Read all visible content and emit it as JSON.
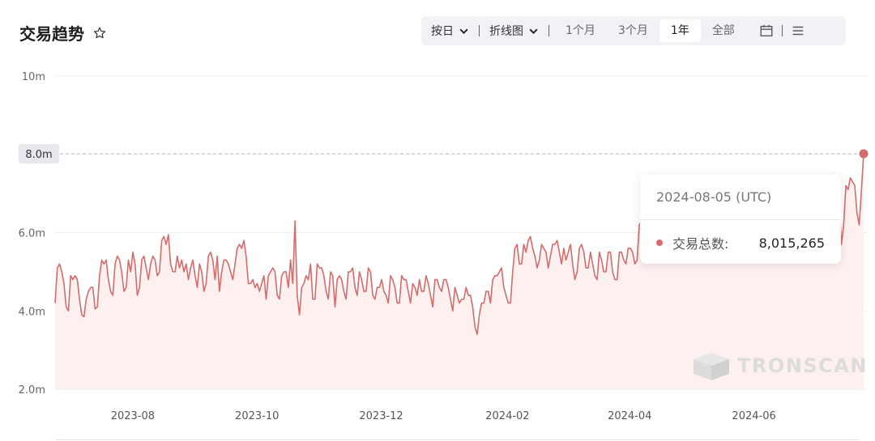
{
  "header": {
    "title": "交易趋势"
  },
  "toolbar": {
    "interval": "按日",
    "chart_kind": "折线图",
    "ranges": [
      "1个月",
      "3个月",
      "1年",
      "全部"
    ],
    "active_range": "1年"
  },
  "tooltip": {
    "date": "2024-08-05 (UTC)",
    "label": "交易总数:",
    "value": "8,015,265"
  },
  "crosshair_label": "8.0m",
  "watermark": "TRONSCAN",
  "colors": {
    "line": "#d66b6b",
    "area": "#fdf0ef",
    "tooltip_dot": "#d66b6b"
  },
  "chart_data": {
    "type": "area",
    "title": "交易趋势",
    "xlabel": "",
    "ylabel": "",
    "ylim": [
      2000000,
      10000000
    ],
    "yticks": [
      2000000,
      4000000,
      6000000,
      8000000,
      10000000
    ],
    "ytick_labels": [
      "2.0m",
      "4.0m",
      "6.0m",
      "8.0m",
      "10m"
    ],
    "xticks": [
      "2023-08-01",
      "2023-10-01",
      "2023-12-01",
      "2024-02-01",
      "2024-04-01",
      "2024-06-01"
    ],
    "xtick_labels": [
      "2023-08",
      "2023-10",
      "2023-12",
      "2024-02",
      "2024-04",
      "2024-06"
    ],
    "x_range": [
      "2023-07-05",
      "2024-08-05"
    ],
    "grid": true,
    "legend": "none",
    "series": [
      {
        "x_start": "2023-07-05",
        "x_step_days": 1,
        "values": [
          4.2,
          5.1,
          5.2,
          5.0,
          4.7,
          4.1,
          4.0,
          4.9,
          4.8,
          4.9,
          4.8,
          4.3,
          3.9,
          3.85,
          4.3,
          4.5,
          4.6,
          4.6,
          4.05,
          4.1,
          4.9,
          5.3,
          5.2,
          5.3,
          4.8,
          4.5,
          4.4,
          5.2,
          5.4,
          5.3,
          5.0,
          4.5,
          4.6,
          5.3,
          5.0,
          5.5,
          5.2,
          4.4,
          4.6,
          5.3,
          5.4,
          5.1,
          4.8,
          5.2,
          5.4,
          5.3,
          4.9,
          5.0,
          5.8,
          5.9,
          5.7,
          5.95,
          5.2,
          5.0,
          5.0,
          5.4,
          5.1,
          5.3,
          5.0,
          5.2,
          4.8,
          5.1,
          5.3,
          4.9,
          4.6,
          5.2,
          5.0,
          4.5,
          4.7,
          5.4,
          5.5,
          5.3,
          4.8,
          5.4,
          4.5,
          5.0,
          5.3,
          5.3,
          5.2,
          5.0,
          4.8,
          5.2,
          5.6,
          5.7,
          5.6,
          5.8,
          5.4,
          4.7,
          4.7,
          4.8,
          4.6,
          4.7,
          4.5,
          4.7,
          4.9,
          4.3,
          4.9,
          5.0,
          5.1,
          5.0,
          4.4,
          4.3,
          4.9,
          5.0,
          5.0,
          4.6,
          5.3,
          4.7,
          6.3,
          4.4,
          3.9,
          4.6,
          4.7,
          4.9,
          4.8,
          5.2,
          4.3,
          4.3,
          5.2,
          5.1,
          5.1,
          4.9,
          4.5,
          4.3,
          5.0,
          4.9,
          4.1,
          4.8,
          4.9,
          4.8,
          4.5,
          4.3,
          5.0,
          5.0,
          5.1,
          4.6,
          4.4,
          5.0,
          4.8,
          4.5,
          4.5,
          5.1,
          5.0,
          4.4,
          4.3,
          4.6,
          4.6,
          4.8,
          4.5,
          4.4,
          4.2,
          4.9,
          4.8,
          4.6,
          4.2,
          4.2,
          4.9,
          4.8,
          4.8,
          4.5,
          4.2,
          4.7,
          4.6,
          4.4,
          4.8,
          4.5,
          4.5,
          4.9,
          4.7,
          4.4,
          4.1,
          4.8,
          4.8,
          4.6,
          4.5,
          4.8,
          4.8,
          4.6,
          4.3,
          4.0,
          4.6,
          4.4,
          4.2,
          4.3,
          4.3,
          4.6,
          4.4,
          4.4,
          4.1,
          3.6,
          3.4,
          3.9,
          4.2,
          4.2,
          4.5,
          4.5,
          4.2,
          4.8,
          4.9,
          4.9,
          5.0,
          5.1,
          4.6,
          4.4,
          4.2,
          4.2,
          5.0,
          5.6,
          5.7,
          5.2,
          5.2,
          5.7,
          5.5,
          5.8,
          5.9,
          5.6,
          5.4,
          5.1,
          5.3,
          5.7,
          5.6,
          5.5,
          5.1,
          5.4,
          5.7,
          5.7,
          5.8,
          5.5,
          5.2,
          5.6,
          5.3,
          5.5,
          5.7,
          5.2,
          4.8,
          5.0,
          5.6,
          5.7,
          5.5,
          5.1,
          5.1,
          5.5,
          5.2,
          4.9,
          4.8,
          5.5,
          5.3,
          5.0,
          5.0,
          5.5,
          5.5,
          5.0,
          4.8,
          4.8,
          5.5,
          5.5,
          5.3,
          5.2,
          5.6,
          5.6,
          5.5,
          5.2,
          5.3,
          6.2,
          6.3,
          6.2,
          6.1,
          6.3,
          5.4,
          5.6,
          6.2,
          6.4,
          6.2,
          5.9,
          5.7,
          5.5,
          5.9,
          6.5,
          6.6,
          6.8,
          6.2,
          5.6,
          6.0,
          6.6,
          6.4,
          6.2,
          6.7,
          6.5,
          6.3,
          6.5,
          6.6,
          6.7,
          6.9,
          7.0,
          6.6,
          6.4,
          6.5,
          6.8,
          6.7,
          6.9,
          6.6,
          6.5,
          6.6,
          6.9,
          6.7,
          6.5,
          6.7,
          6.8,
          7.0,
          7.1,
          6.7,
          6.6,
          6.5,
          6.8,
          6.9,
          6.7,
          6.5,
          6.8,
          7.0,
          6.9,
          6.6,
          6.5,
          6.7,
          6.9,
          7.0,
          6.8,
          6.6,
          6.9,
          7.1,
          7.0,
          6.8,
          7.2,
          7.0,
          6.9,
          6.8,
          6.9,
          7.1,
          6.8,
          6.6,
          6.8,
          7.0,
          6.9,
          7.1,
          6.8,
          6.7,
          6.9,
          6.8,
          7.0,
          6.9,
          6.8,
          6.5,
          6.3,
          6.4,
          6.8,
          5.7,
          6.2,
          7.2,
          7.1,
          7.4,
          7.3,
          7.2,
          6.5,
          6.2,
          7.1,
          8.015
        ]
      }
    ]
  }
}
